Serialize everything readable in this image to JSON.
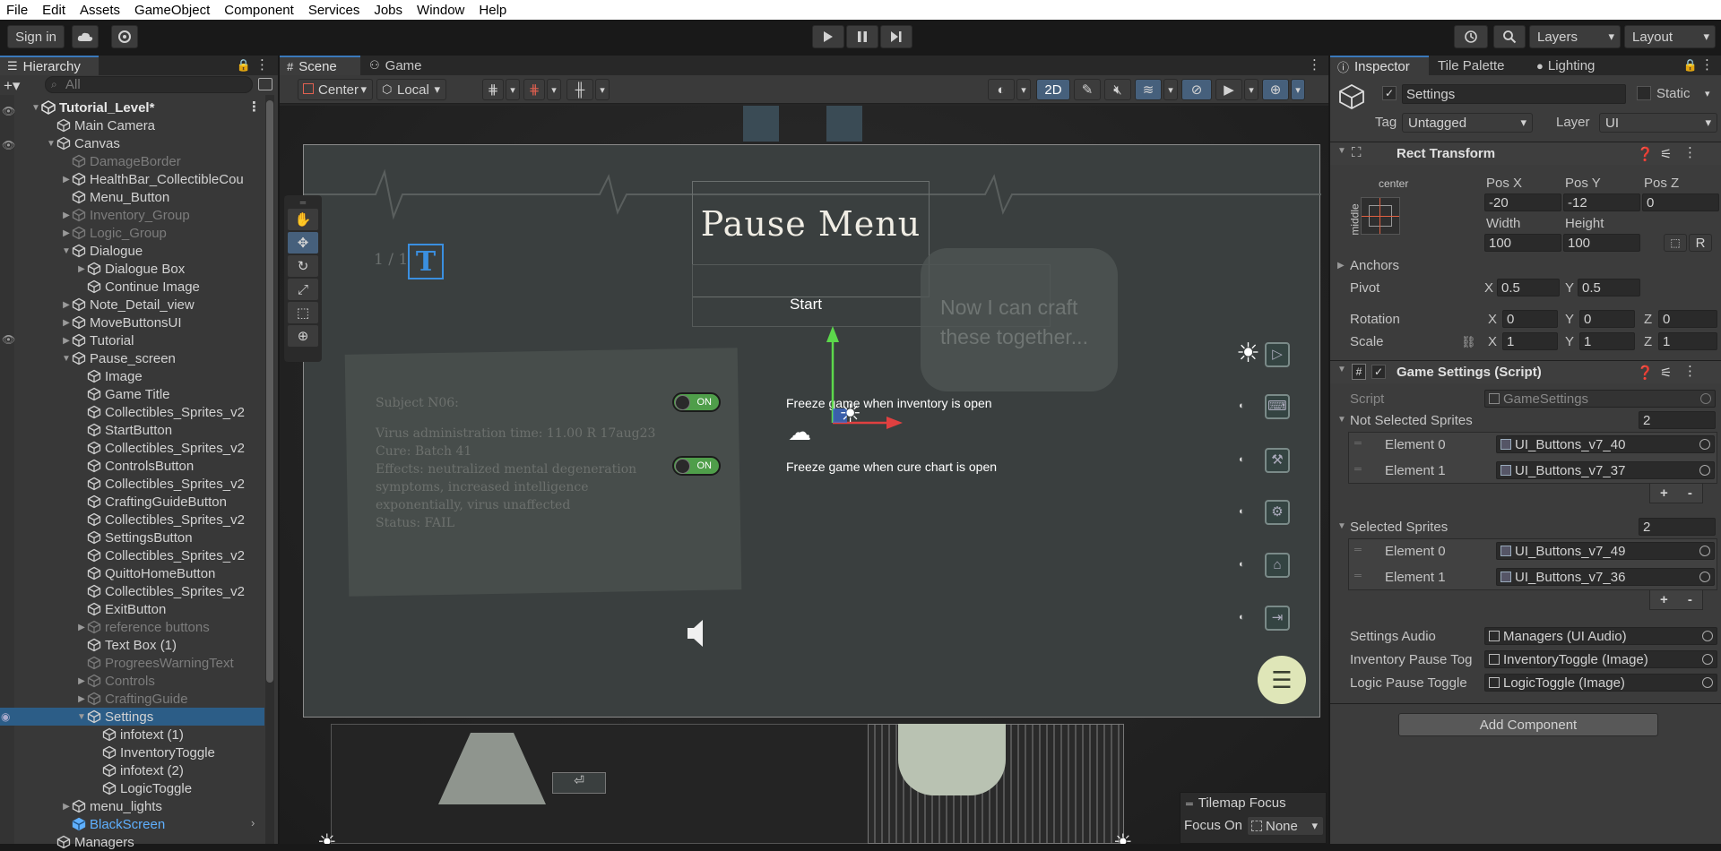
{
  "menu": [
    "File",
    "Edit",
    "Assets",
    "GameObject",
    "Component",
    "Services",
    "Jobs",
    "Window",
    "Help"
  ],
  "toolbar": {
    "sign_in": "Sign in",
    "layers": "Layers",
    "layout": "Layout"
  },
  "hierarchy": {
    "tab": "Hierarchy",
    "search_placeholder": "All",
    "scene_name": "Tutorial_Level*",
    "items": [
      {
        "label": "Main Camera",
        "depth": 1,
        "arrow": false,
        "state": "normal"
      },
      {
        "label": "Canvas",
        "depth": 1,
        "arrow": "open",
        "state": "normal"
      },
      {
        "label": "DamageBorder",
        "depth": 2,
        "arrow": false,
        "state": "dim"
      },
      {
        "label": "HealthBar_CollectibleCou",
        "depth": 2,
        "arrow": "closed",
        "state": "normal"
      },
      {
        "label": "Menu_Button",
        "depth": 2,
        "arrow": false,
        "state": "normal"
      },
      {
        "label": "Inventory_Group",
        "depth": 2,
        "arrow": "closed",
        "state": "dim"
      },
      {
        "label": "Logic_Group",
        "depth": 2,
        "arrow": "closed",
        "state": "dim"
      },
      {
        "label": "Dialogue",
        "depth": 2,
        "arrow": "open",
        "state": "normal"
      },
      {
        "label": "Dialogue Box",
        "depth": 3,
        "arrow": "closed",
        "state": "normal"
      },
      {
        "label": "Continue Image",
        "depth": 3,
        "arrow": false,
        "state": "normal"
      },
      {
        "label": "Note_Detail_view",
        "depth": 2,
        "arrow": "closed",
        "state": "normal"
      },
      {
        "label": "MoveButtonsUI",
        "depth": 2,
        "arrow": "closed",
        "state": "normal"
      },
      {
        "label": "Tutorial",
        "depth": 2,
        "arrow": "closed",
        "state": "normal"
      },
      {
        "label": "Pause_screen",
        "depth": 2,
        "arrow": "open",
        "state": "normal"
      },
      {
        "label": "Image",
        "depth": 3,
        "arrow": false,
        "state": "normal"
      },
      {
        "label": "Game Title",
        "depth": 3,
        "arrow": false,
        "state": "normal"
      },
      {
        "label": "Collectibles_Sprites_v2",
        "depth": 3,
        "arrow": false,
        "state": "normal"
      },
      {
        "label": "StartButton",
        "depth": 3,
        "arrow": false,
        "state": "normal"
      },
      {
        "label": "Collectibles_Sprites_v2",
        "depth": 3,
        "arrow": false,
        "state": "normal"
      },
      {
        "label": "ControlsButton",
        "depth": 3,
        "arrow": false,
        "state": "normal"
      },
      {
        "label": "Collectibles_Sprites_v2",
        "depth": 3,
        "arrow": false,
        "state": "normal"
      },
      {
        "label": "CraftingGuideButton",
        "depth": 3,
        "arrow": false,
        "state": "normal"
      },
      {
        "label": "Collectibles_Sprites_v2",
        "depth": 3,
        "arrow": false,
        "state": "normal"
      },
      {
        "label": "SettingsButton",
        "depth": 3,
        "arrow": false,
        "state": "normal"
      },
      {
        "label": "Collectibles_Sprites_v2",
        "depth": 3,
        "arrow": false,
        "state": "normal"
      },
      {
        "label": "QuittoHomeButton",
        "depth": 3,
        "arrow": false,
        "state": "normal"
      },
      {
        "label": "Collectibles_Sprites_v2",
        "depth": 3,
        "arrow": false,
        "state": "normal"
      },
      {
        "label": "ExitButton",
        "depth": 3,
        "arrow": false,
        "state": "normal"
      },
      {
        "label": "reference buttons",
        "depth": 3,
        "arrow": "closed",
        "state": "dim"
      },
      {
        "label": "Text Box (1)",
        "depth": 3,
        "arrow": false,
        "state": "normal"
      },
      {
        "label": "ProgreesWarningText",
        "depth": 3,
        "arrow": false,
        "state": "dim"
      },
      {
        "label": "Controls",
        "depth": 3,
        "arrow": "closed",
        "state": "dim"
      },
      {
        "label": "CraftingGuide",
        "depth": 3,
        "arrow": "closed",
        "state": "dim"
      },
      {
        "label": "Settings",
        "depth": 3,
        "arrow": "open",
        "state": "selected"
      },
      {
        "label": "infotext (1)",
        "depth": 4,
        "arrow": false,
        "state": "normal"
      },
      {
        "label": "InventoryToggle",
        "depth": 4,
        "arrow": false,
        "state": "normal"
      },
      {
        "label": "infotext (2)",
        "depth": 4,
        "arrow": false,
        "state": "normal"
      },
      {
        "label": "LogicToggle",
        "depth": 4,
        "arrow": false,
        "state": "normal"
      },
      {
        "label": "menu_lights",
        "depth": 2,
        "arrow": "closed",
        "state": "normal"
      },
      {
        "label": "BlackScreen",
        "depth": 2,
        "arrow": false,
        "state": "blue"
      },
      {
        "label": "Managers",
        "depth": 1,
        "arrow": false,
        "state": "normal"
      }
    ]
  },
  "scene": {
    "tabs": [
      "Scene",
      "Game"
    ],
    "pivot": "Center",
    "space": "Local",
    "mode_2d": "2D",
    "pause_title": "Pause Menu",
    "start_label": "Start",
    "toggle_on": "ON",
    "freeze_inventory": "Freeze game when inventory is open",
    "freeze_cure": "Freeze game when cure chart is open",
    "note_lines": [
      "Subject N06:",
      "Virus administration time: 11.00 R 17aug23",
      "Cure: Batch 41",
      "Effects: neutralized mental degeneration",
      "symptoms, increased intelligence",
      "exponentially, virus unaffected",
      "Status: FAIL"
    ],
    "speech_text": "Now I can craft these together...",
    "page_counter": "1 / 1",
    "tilemap_focus": "Tilemap Focus",
    "focus_on": "Focus On",
    "focus_value": "None"
  },
  "inspector": {
    "tabs": [
      "Inspector",
      "Tile Palette",
      "Lighting"
    ],
    "object_name": "Settings",
    "static_label": "Static",
    "tag_label": "Tag",
    "tag_value": "Untagged",
    "layer_label": "Layer",
    "layer_value": "UI",
    "rect_transform": {
      "title": "Rect Transform",
      "anchor_h": "center",
      "anchor_v": "middle",
      "pos_x_label": "Pos X",
      "pos_y_label": "Pos Y",
      "pos_z_label": "Pos Z",
      "pos_x": "-20",
      "pos_y": "-12",
      "pos_z": "0",
      "width_label": "Width",
      "height_label": "Height",
      "width": "100",
      "height": "100",
      "r_button": "R",
      "anchors_label": "Anchors",
      "pivot_label": "Pivot",
      "pivot_x": "0.5",
      "pivot_y": "0.5",
      "rotation_label": "Rotation",
      "rot_x": "0",
      "rot_y": "0",
      "rot_z": "0",
      "scale_label": "Scale",
      "scale_x": "1",
      "scale_y": "1",
      "scale_z": "1",
      "x": "X",
      "y": "Y",
      "z": "Z"
    },
    "script_component": {
      "title": "Game Settings (Script)",
      "script_label": "Script",
      "script_value": "GameSettings",
      "not_selected_label": "Not Selected Sprites",
      "not_selected_count": "2",
      "not_selected": [
        {
          "label": "Element 0",
          "value": "UI_Buttons_v7_40"
        },
        {
          "label": "Element 1",
          "value": "UI_Buttons_v7_37"
        }
      ],
      "selected_label": "Selected Sprites",
      "selected_count": "2",
      "selected": [
        {
          "label": "Element 0",
          "value": "UI_Buttons_v7_49"
        },
        {
          "label": "Element 1",
          "value": "UI_Buttons_v7_36"
        }
      ],
      "plus": "+",
      "minus": "-",
      "settings_audio_label": "Settings Audio",
      "settings_audio_value": "Managers (UI Audio)",
      "inventory_toggle_label": "Inventory Pause Tog",
      "inventory_toggle_value": "InventoryToggle (Image)",
      "logic_toggle_label": "Logic Pause Toggle",
      "logic_toggle_value": "LogicToggle (Image)"
    },
    "add_component": "Add Component"
  },
  "colors": {
    "accent_blue": "#3a79bb",
    "selection": "#2c5d87",
    "toggle_green": "#4f9e4a",
    "scene_bg": "#262626"
  },
  "icons": [
    "play-icon",
    "pause-icon",
    "step-icon",
    "cloud-icon",
    "collab-icon",
    "history-icon",
    "search-icon",
    "cube-icon",
    "gear-icon"
  ]
}
